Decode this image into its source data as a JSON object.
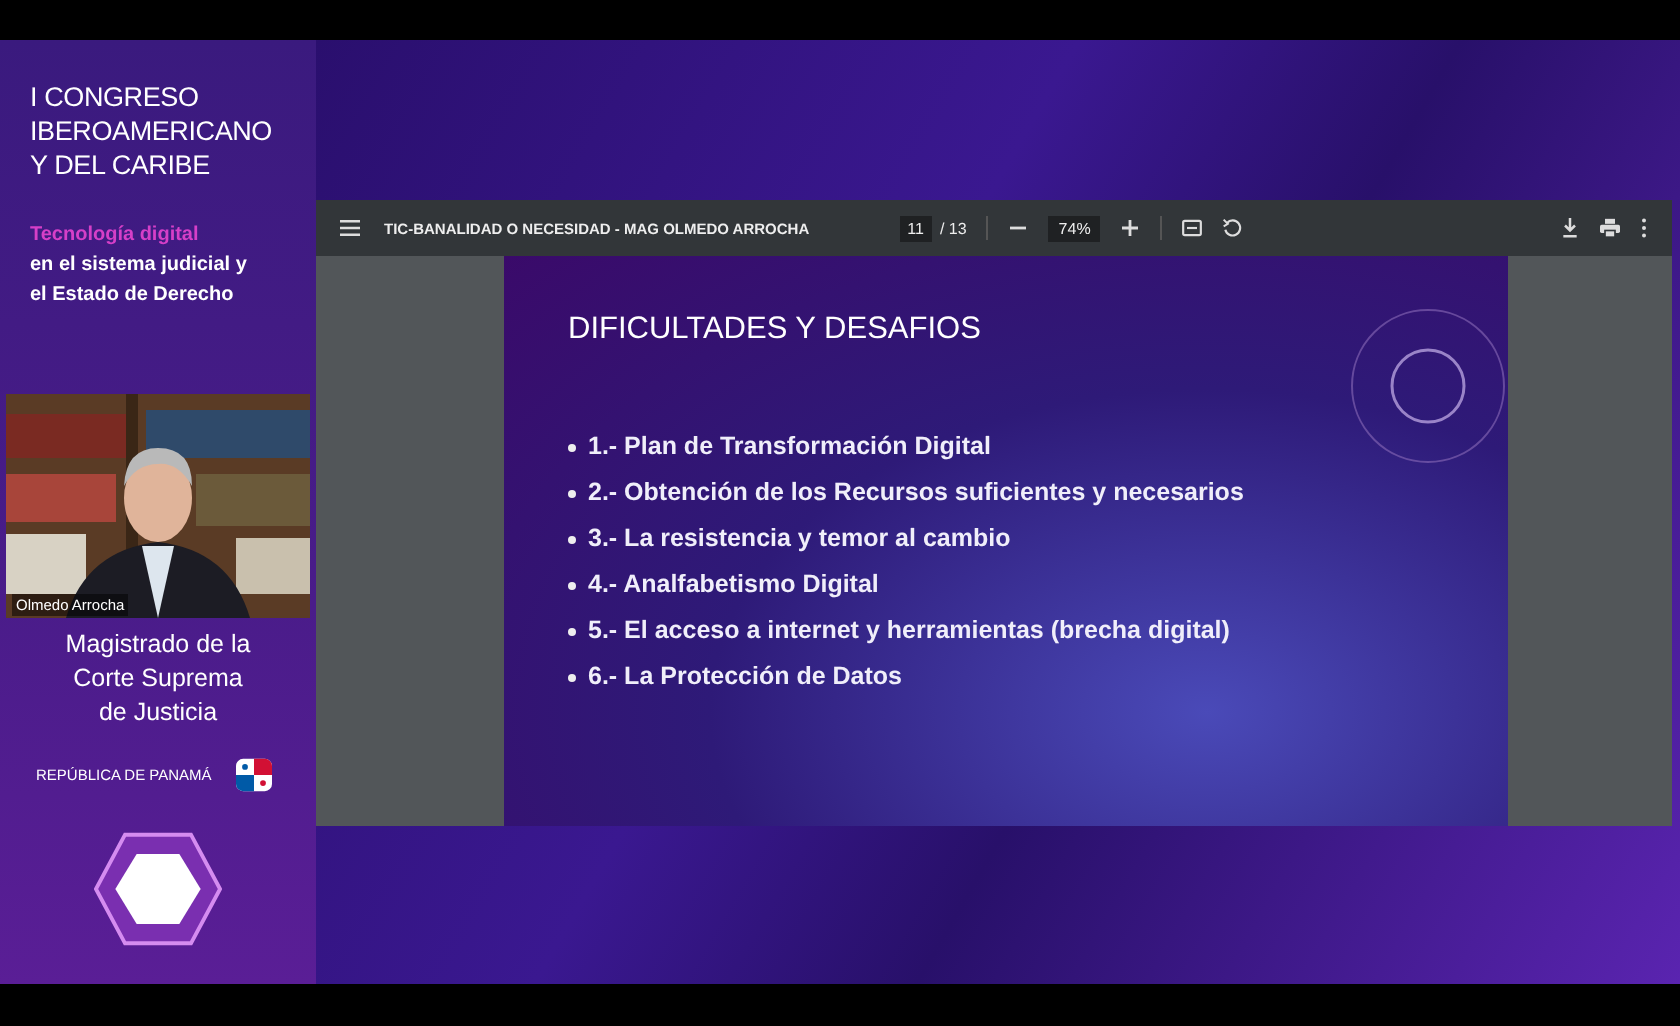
{
  "sidebar": {
    "event_title": [
      "I CONGRESO",
      "IBEROAMERICANO",
      "Y DEL CARIBE"
    ],
    "subtitle_highlight": "Tecnología digital",
    "subtitle": [
      "en el sistema judicial y",
      "el Estado de Derecho"
    ],
    "video": {
      "kind": "picture",
      "caption": "Olmedo Arrocha"
    },
    "speaker_role": [
      "Magistrado de la",
      "Corte Suprema",
      "de Justicia"
    ],
    "country": "REPÚBLICA DE PANAMÁ"
  },
  "pdf_viewer": {
    "title": "TIC-BANALIDAD O NECESIDAD - MAG OLMEDO ARROCHA",
    "page": "11",
    "page_total": "/ 13",
    "zoom": "74%",
    "slide": {
      "title": "DIFICULTADES Y DESAFIOS",
      "bullets": [
        "1.- Plan de Transformación Digital",
        "2.- Obtención de los Recursos suficientes y necesarios",
        "3.- La resistencia y temor al cambio",
        "4.- Analfabetismo Digital",
        "5.- El acceso a internet y herramientas (brecha digital)",
        "6.- La Protección de Datos"
      ]
    }
  }
}
